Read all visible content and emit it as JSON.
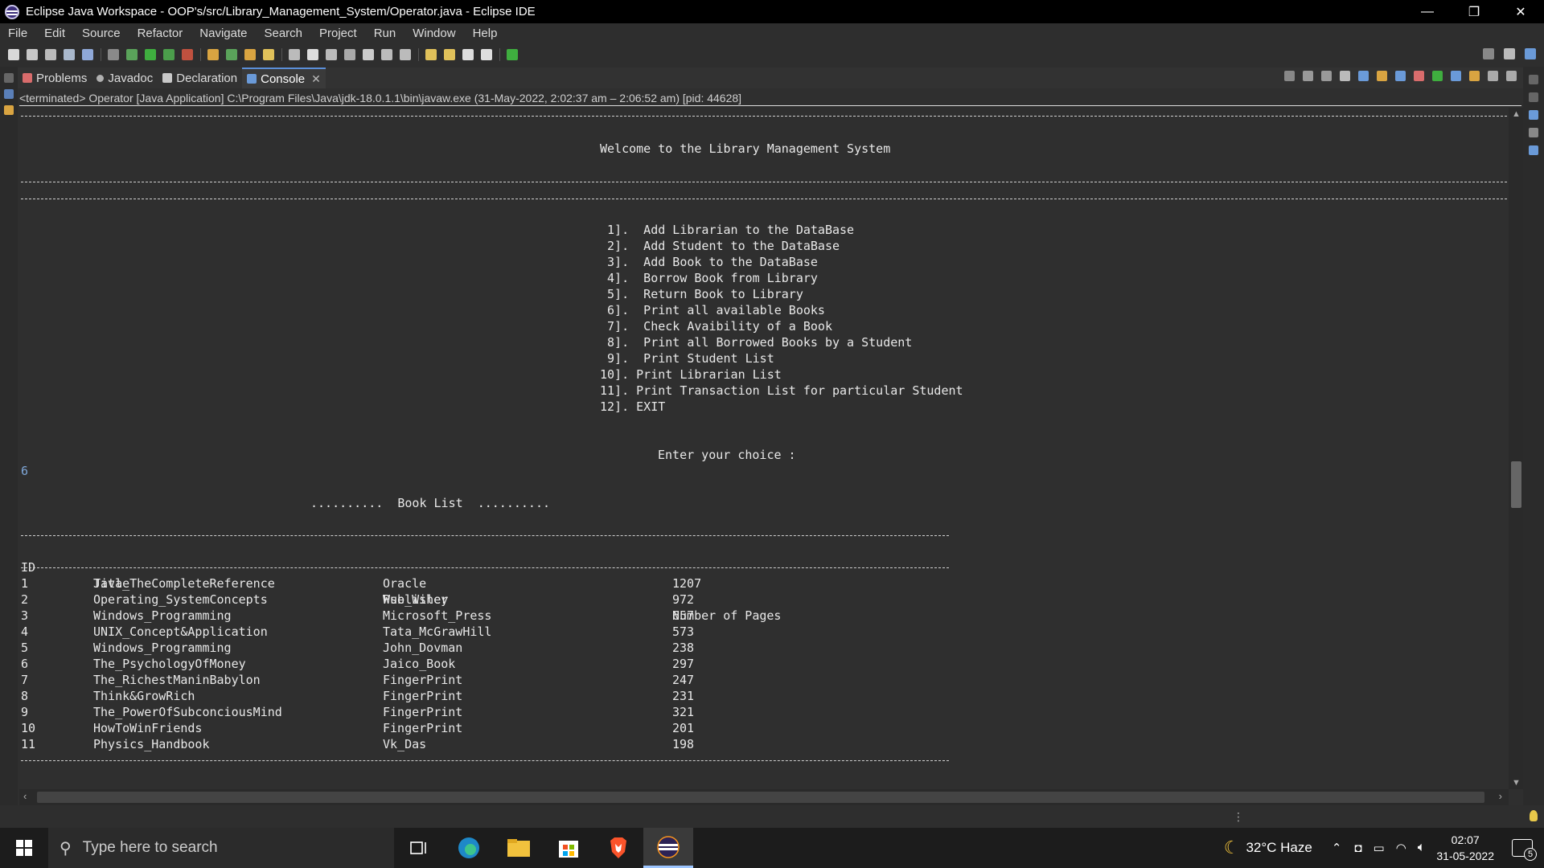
{
  "window": {
    "title": "Eclipse Java Workspace - OOP's/src/Library_Management_System/Operator.java - Eclipse IDE",
    "minimize": "—",
    "restore": "❐",
    "close": "✕"
  },
  "menu": [
    "File",
    "Edit",
    "Source",
    "Refactor",
    "Navigate",
    "Search",
    "Project",
    "Run",
    "Window",
    "Help"
  ],
  "tabs": [
    {
      "label": "Problems",
      "icon": "problems-icon"
    },
    {
      "label": "Javadoc",
      "icon": "javadoc-icon"
    },
    {
      "label": "Declaration",
      "icon": "declaration-icon"
    },
    {
      "label": "Console",
      "icon": "console-icon",
      "close": "✕"
    }
  ],
  "console": {
    "status": "<terminated> Operator [Java Application] C:\\Program Files\\Java\\jdk-18.0.1.1\\bin\\javaw.exe  (31-May-2022, 2:02:37 am – 2:06:52 am) [pid: 44628]",
    "welcome": "Welcome to the Library Management System",
    "menu_items": [
      " 1].  Add Librarian to the DataBase",
      " 2].  Add Student to the DataBase",
      " 3].  Add Book to the DataBase",
      " 4].  Borrow Book from Library",
      " 5].  Return Book to Library",
      " 6].  Print all available Books",
      " 7].  Check Avaibility of a Book",
      " 8].  Print all Borrowed Books by a Student",
      " 9].  Print Student List",
      "10]. Print Librarian List",
      "11]. Print Transaction List for particular Student",
      "12]. EXIT"
    ],
    "prompt": "Enter your choice :",
    "user_input": "6",
    "book_list_title": "..........  Book List  ..........",
    "headers": [
      "ID",
      "Title",
      "Publisher",
      "Number of Pages"
    ],
    "books": [
      [
        "1",
        "Java_TheCompleteReference",
        "Oracle",
        "1207"
      ],
      [
        "2",
        "Operating_SystemConcepts",
        "Wse_Wiley",
        "972"
      ],
      [
        "3",
        "Windows_Programming",
        "Microsoft_Press",
        "657"
      ],
      [
        "4",
        "UNIX_Concept&Application",
        "Tata_McGrawHill",
        "573"
      ],
      [
        "5",
        "Windows_Programming",
        "John_Dovman",
        "238"
      ],
      [
        "6",
        "The_PsychologyOfMoney",
        "Jaico_Book",
        "297"
      ],
      [
        "7",
        "The_RichestManinBabylon",
        "FingerPrint",
        "247"
      ],
      [
        "8",
        "Think&GrowRich",
        "FingerPrint",
        "231"
      ],
      [
        "9",
        "The_PowerOfSubconciousMind",
        "FingerPrint",
        "321"
      ],
      [
        "10",
        "HowToWinFriends",
        "FingerPrint",
        "201"
      ],
      [
        "11",
        "Physics_Handbook",
        "Vk_Das",
        "198"
      ]
    ]
  },
  "taskbar": {
    "search_placeholder": "Type here to search",
    "weather": "32°C  Haze",
    "time": "02:07",
    "date": "31-05-2022",
    "notifications": "5"
  }
}
